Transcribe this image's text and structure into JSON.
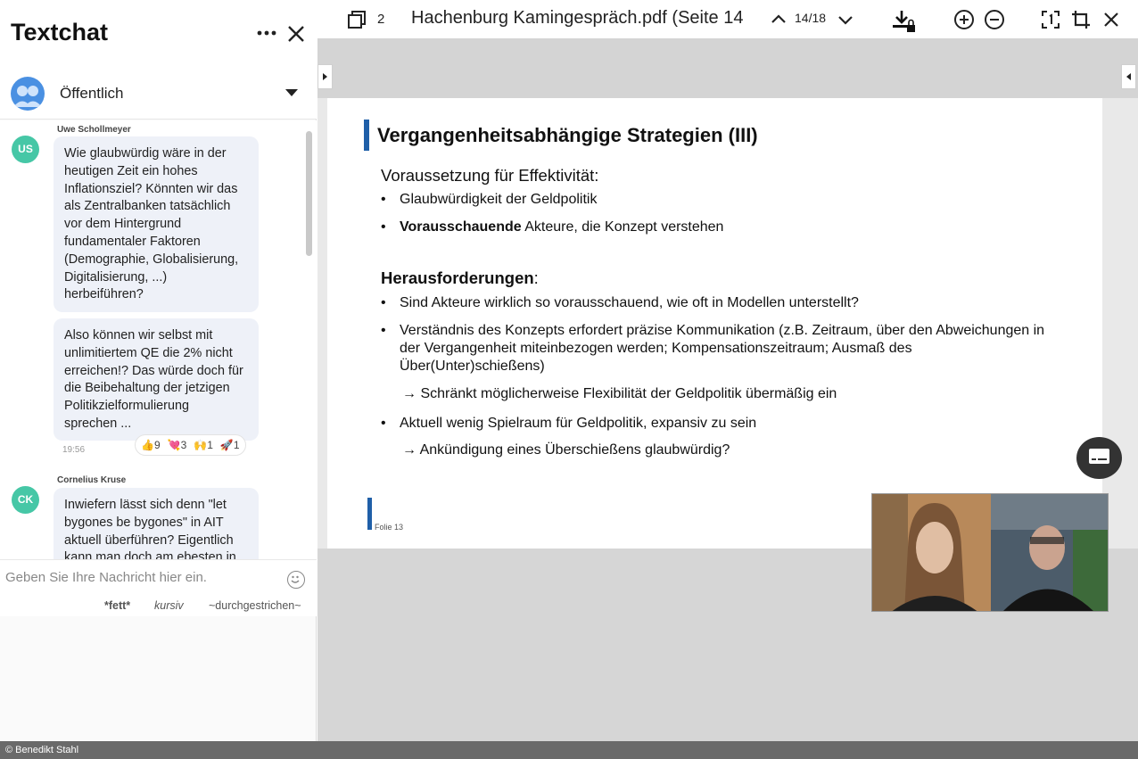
{
  "chat": {
    "title": "Textchat",
    "channel": "Öffentlich",
    "messages": [
      {
        "sender": "Uwe Schollmeyer",
        "initials": "US",
        "bubbles": [
          "Wie glaubwürdig wäre in der\nheutigen Zeit ein hohes\nInflationsziel? Könnten wir das\nals Zentralbanken tatsächlich\nvor dem Hintergrund\nfundamentaler Faktoren\n(Demographie, Globalisierung,\nDigitalisierung, ...)\nherbeiführen?",
          "Also können wir selbst mit\nunlimitiertem QE die 2% nicht\nerreichen!? Das würde doch für\ndie Beibehaltung der jetzigen\nPolitikzielformulierung\nsprechen ..."
        ],
        "time": "19:56"
      },
      {
        "sender": "Cornelius Kruse",
        "initials": "CK",
        "bubbles": [
          "Inwiefern lässt sich denn \"let\nbygones be bygones\" in AIT\naktuell überführen? Eigentlich\nkann man doch am ebesten in"
        ]
      }
    ],
    "reactions": [
      {
        "emoji": "👍",
        "count": "9"
      },
      {
        "emoji": "💘",
        "count": "3"
      },
      {
        "emoji": "🙌",
        "count": "1"
      },
      {
        "emoji": "🚀",
        "count": "1"
      }
    ],
    "composer": {
      "placeholder": "Geben Sie Ihre Nachricht hier ein.",
      "bold": "*fett*",
      "italic": "kursiv",
      "strike": "~durchgestrichen~"
    }
  },
  "viewer": {
    "pages_count": "2",
    "doc_title": "Hachenburg Kamingespräch.pdf (Seite 14",
    "page_indicator": "14/18"
  },
  "slide": {
    "title": "Vergangenheitsabhängige Strategien (III)",
    "section1": "Voraussetzung für Effektivität:",
    "bullet1": "Glaubwürdigkeit der Geldpolitik",
    "bullet2_bold": "Vorausschauende",
    "bullet2_rest": " Akteure, die Konzept verstehen",
    "section2_bold": "Herausforderungen",
    "section2_rest": ":",
    "bullet3": "Sind Akteure wirklich so vorausschauend, wie oft in Modellen unterstellt?",
    "bullet4": "Verständnis des Konzepts erfordert präzise Kommunikation (z.B. Zeitraum, über den Abweichungen in\nder Vergangenheit miteinbezogen werden; Kompensationszeitraum; Ausmaß des\nÜber(Unter)schießens)",
    "arrow1": "→ Schränkt möglicherweise Flexibilität der Geldpolitik übermäßig ein",
    "bullet5": "Aktuell wenig Spielraum für Geldpolitik, expansiv zu sein",
    "arrow2": "→ Ankündigung eines Überschießens glaubwürdig?",
    "footer": "Folie 13"
  },
  "credit": "© Benedikt Stahl",
  "colors": {
    "accent": "#1f5fa8",
    "avatar": "#46c7a6",
    "bubble": "#eef1f8"
  }
}
